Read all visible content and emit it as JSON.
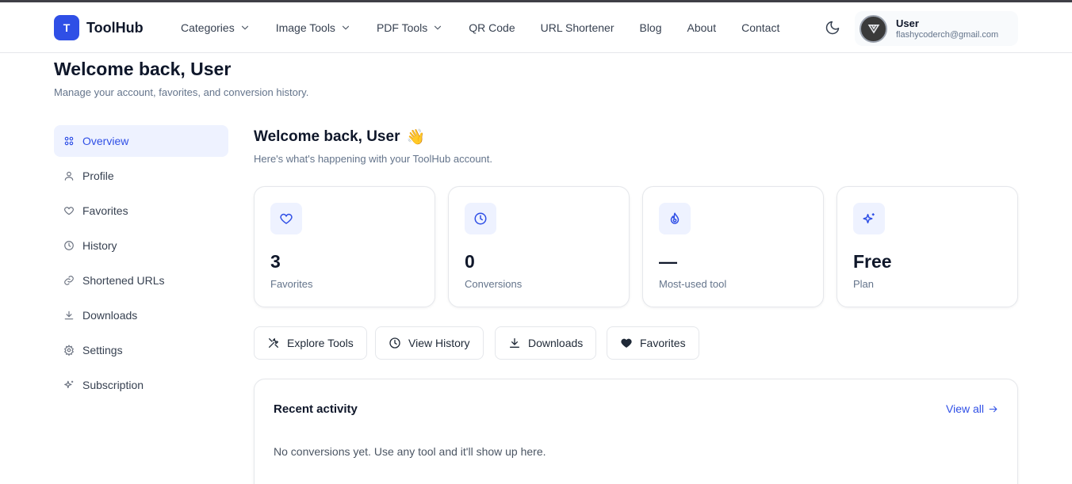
{
  "brand": {
    "logo_letter": "T",
    "name": "ToolHub",
    "accent": "#2f4fe6"
  },
  "nav": {
    "items": [
      {
        "label": "Categories",
        "dropdown": true
      },
      {
        "label": "Image Tools",
        "dropdown": true
      },
      {
        "label": "PDF Tools",
        "dropdown": true
      },
      {
        "label": "QR Code",
        "dropdown": false
      },
      {
        "label": "URL Shortener",
        "dropdown": false
      },
      {
        "label": "Blog",
        "dropdown": false
      },
      {
        "label": "About",
        "dropdown": false
      },
      {
        "label": "Contact",
        "dropdown": false
      }
    ],
    "theme_icon": "moon-icon"
  },
  "user": {
    "name": "User",
    "email": "flashycoderch@gmail.com"
  },
  "page": {
    "title": "Welcome back, User",
    "subtitle": "Manage your account, favorites, and conversion history."
  },
  "sidebar": {
    "items": [
      {
        "label": "Overview",
        "icon": "grid-icon",
        "active": true
      },
      {
        "label": "Profile",
        "icon": "user-icon",
        "active": false
      },
      {
        "label": "Favorites",
        "icon": "heart-icon",
        "active": false
      },
      {
        "label": "History",
        "icon": "clock-icon",
        "active": false
      },
      {
        "label": "Shortened URLs",
        "icon": "link-icon",
        "active": false
      },
      {
        "label": "Downloads",
        "icon": "download-icon",
        "active": false
      },
      {
        "label": "Settings",
        "icon": "gear-icon",
        "active": false
      },
      {
        "label": "Subscription",
        "icon": "sparkles-icon",
        "active": false
      }
    ]
  },
  "main": {
    "title": "Welcome back, User",
    "title_emoji": "👋",
    "subtitle": "Here's what's happening with your ToolHub account.",
    "stats": [
      {
        "value": "3",
        "label": "Favorites",
        "icon": "heart-icon"
      },
      {
        "value": "0",
        "label": "Conversions",
        "icon": "clock-icon"
      },
      {
        "value": "—",
        "label": "Most-used tool",
        "icon": "flame-icon"
      },
      {
        "value": "Free",
        "label": "Plan",
        "icon": "sparkles-icon"
      }
    ],
    "quick_actions": [
      {
        "label": "Explore Tools",
        "icon": "tools-icon"
      },
      {
        "label": "View History",
        "icon": "clock-icon"
      },
      {
        "label": "Downloads",
        "icon": "download-icon"
      },
      {
        "label": "Favorites",
        "icon": "heart-filled-icon"
      }
    ],
    "activity": {
      "title": "Recent activity",
      "view_all": "View all",
      "empty_text": "No conversions yet. Use any tool and it'll show up here."
    }
  }
}
